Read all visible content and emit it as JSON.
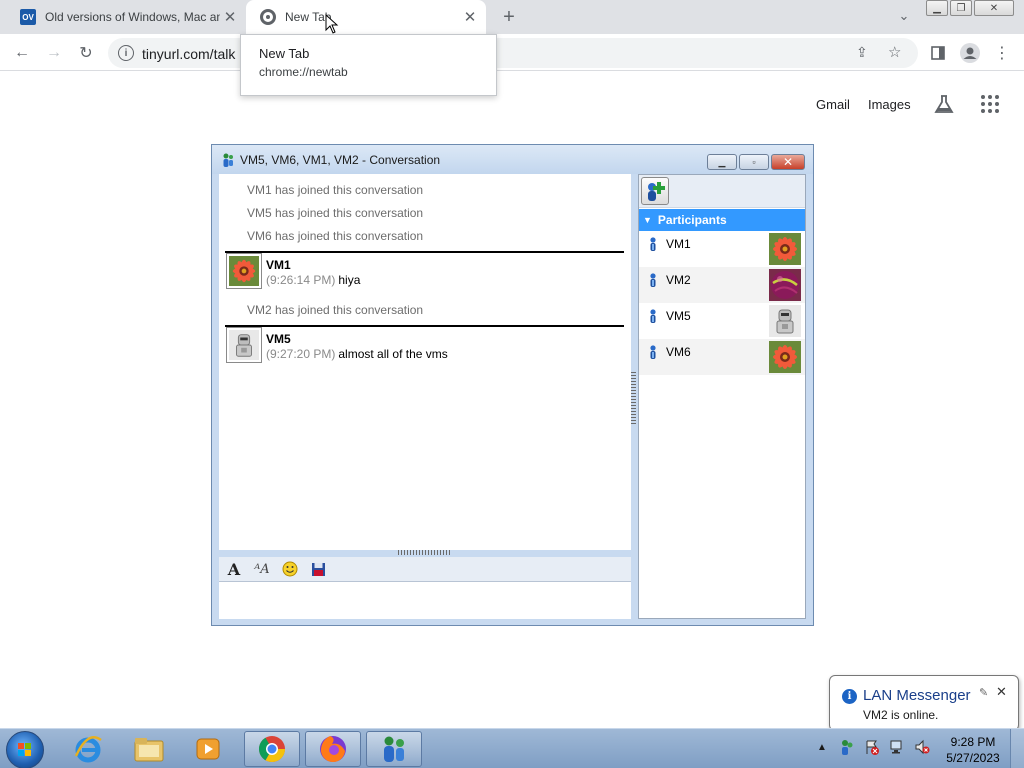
{
  "browser": {
    "tabs": [
      {
        "label": "Old versions of Windows, Mac an",
        "favicon": "OV"
      },
      {
        "label": "New Tab"
      }
    ],
    "address": "tinyurl.com/talk",
    "tooltip": {
      "title": "New Tab",
      "url": "chrome://newtab"
    },
    "google_links": {
      "gmail": "Gmail",
      "images": "Images"
    }
  },
  "conversation": {
    "title": "VM5, VM6, VM1, VM2 - Conversation",
    "events": {
      "vm1_joined": "VM1 has joined this conversation",
      "vm5_joined": "VM5 has joined this conversation",
      "vm6_joined": "VM6 has joined this conversation",
      "vm2_joined": "VM2 has joined this conversation"
    },
    "messages": [
      {
        "sender": "VM1",
        "time": "(9:26:14 PM)",
        "text": "hiya"
      },
      {
        "sender": "VM5",
        "time": "(9:27:20 PM)",
        "text": "almost all of the vms"
      }
    ],
    "participants_header": "Participants",
    "participants": [
      "VM1",
      "VM2",
      "VM5",
      "VM6"
    ]
  },
  "notification": {
    "title": "LAN Messenger",
    "message": "VM2 is online."
  },
  "taskbar": {
    "time": "9:28 PM",
    "date": "5/27/2023"
  },
  "colors": {
    "participants_header": "#3399ff",
    "chrome_strip": "#dfe1e5",
    "taskbar": "#8fabd0"
  }
}
